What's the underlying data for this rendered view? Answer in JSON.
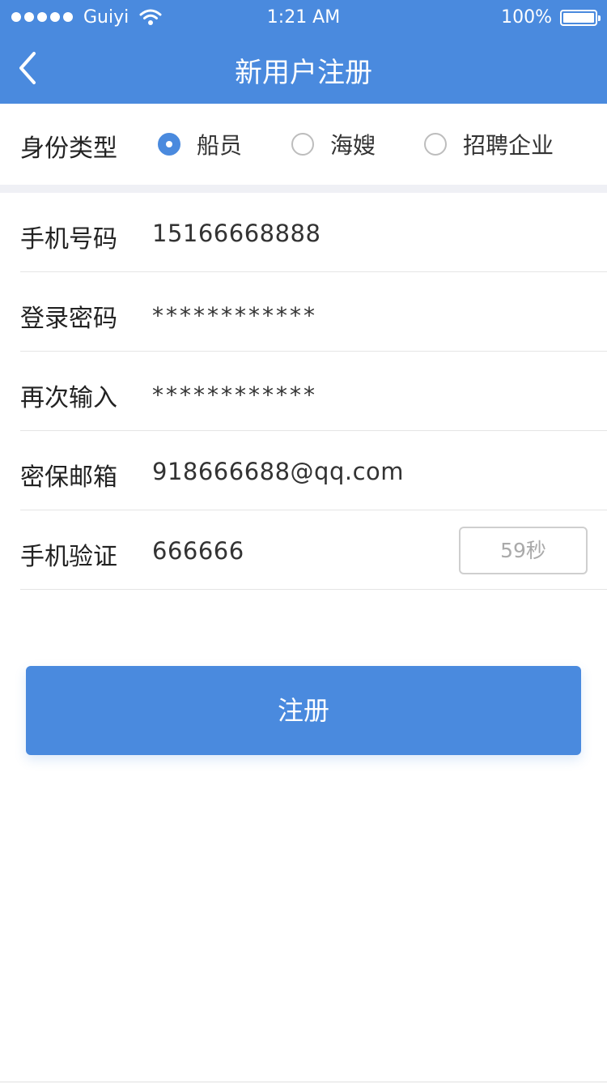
{
  "status_bar": {
    "carrier": "Guiyi",
    "time": "1:21 AM",
    "battery": "100%"
  },
  "nav": {
    "title": "新用户注册",
    "back_icon": "chevron-left-icon"
  },
  "identity": {
    "label": "身份类型",
    "options": [
      "船员",
      "海嫂",
      "招聘企业"
    ],
    "selected": "船员"
  },
  "form": {
    "phone": {
      "label": "手机号码",
      "value": "15166668888"
    },
    "password": {
      "label": "登录密码",
      "value": "************"
    },
    "password_confirm": {
      "label": "再次输入",
      "value": "************"
    },
    "security_email": {
      "label": "密保邮箱",
      "value": "918666688@qq.com"
    },
    "sms_code": {
      "label": "手机验证",
      "value": "666666",
      "countdown": "59秒"
    }
  },
  "submit_label": "注册",
  "colors": {
    "primary": "#4a8ade",
    "separator": "#eff0f5"
  }
}
